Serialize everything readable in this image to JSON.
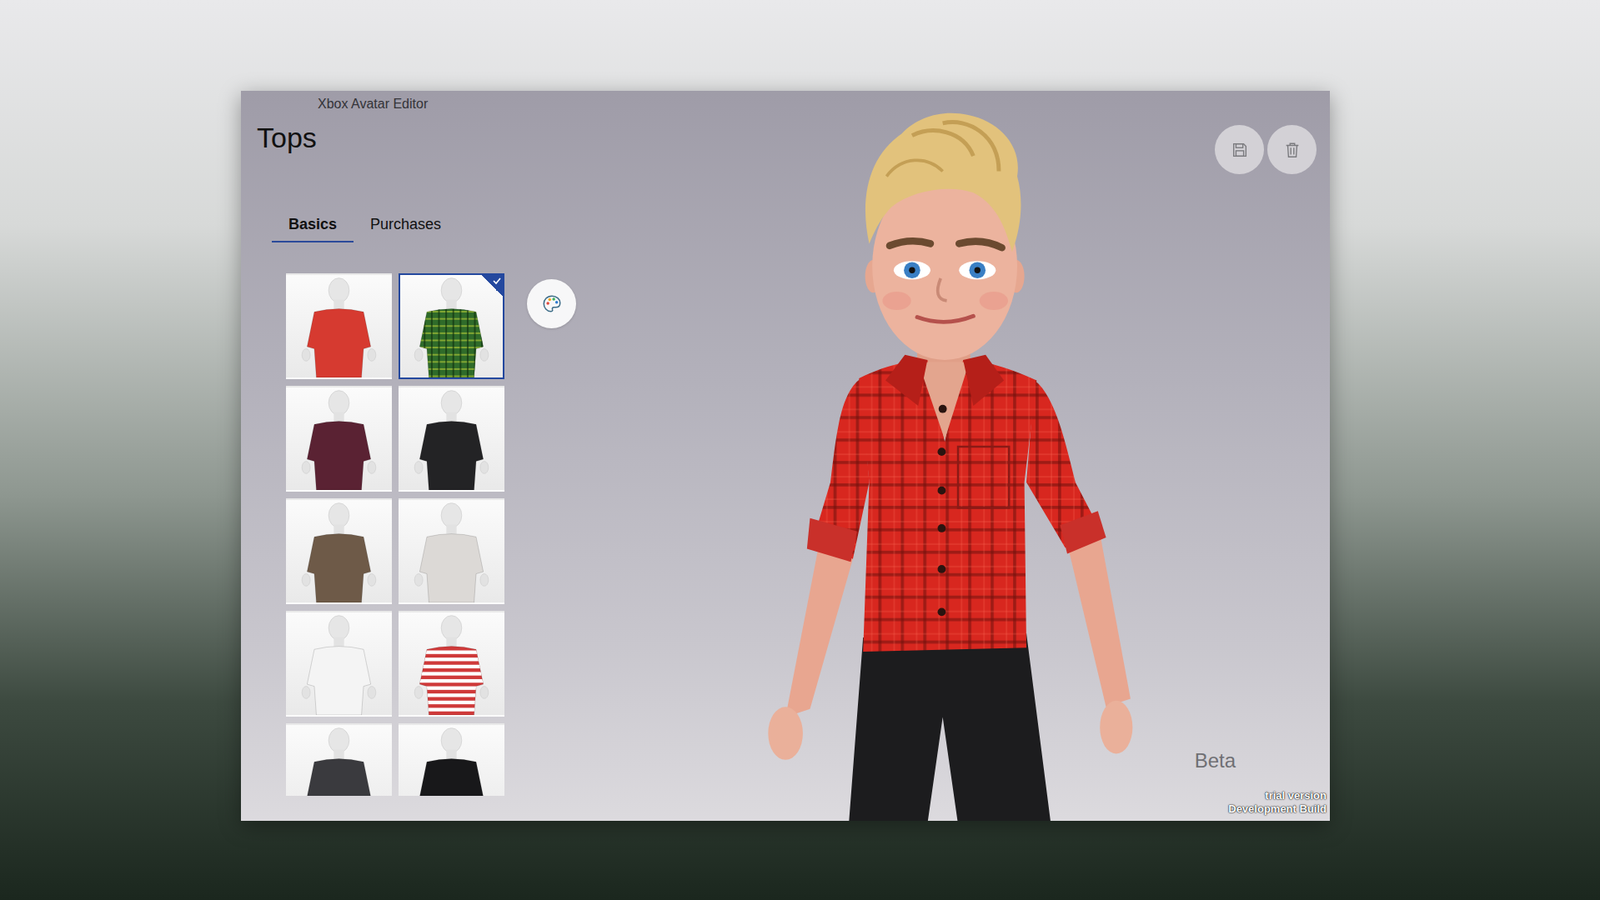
{
  "window": {
    "title": "Xbox Avatar Editor"
  },
  "page": {
    "heading": "Tops"
  },
  "tabs": [
    {
      "label": "Basics",
      "selected": true
    },
    {
      "label": "Purchases",
      "selected": false
    }
  ],
  "tops": [
    {
      "kind": "plain",
      "color": "#d63a30",
      "selected": false
    },
    {
      "kind": "plaid",
      "color": "#2f6b2a",
      "selected": true
    },
    {
      "kind": "plain",
      "color": "#5a2233",
      "selected": false
    },
    {
      "kind": "plain",
      "color": "#232325",
      "selected": false
    },
    {
      "kind": "plain",
      "color": "#6e5a48",
      "selected": false
    },
    {
      "kind": "plain",
      "color": "#dcd9d6",
      "selected": false
    },
    {
      "kind": "plain",
      "color": "#f4f4f4",
      "selected": false
    },
    {
      "kind": "stripes",
      "color": "#cf3a3a",
      "selected": false
    },
    {
      "kind": "plain",
      "color": "#3a3a3e",
      "selected": false
    },
    {
      "kind": "plain",
      "color": "#18181a",
      "selected": false
    }
  ],
  "badge": "Beta",
  "watermark": [
    "trial version",
    "Development Build"
  ]
}
